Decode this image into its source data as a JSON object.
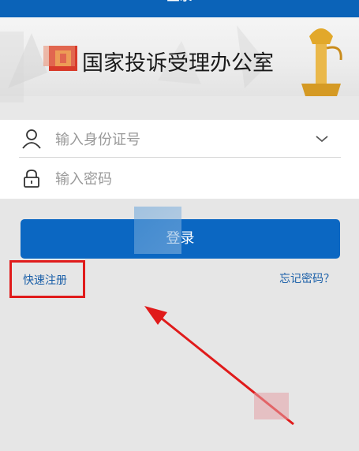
{
  "header": {
    "title": "登录"
  },
  "banner": {
    "org_name": "国家投诉受理办公室"
  },
  "form": {
    "id_placeholder": "输入身份证号",
    "password_placeholder": "输入密码"
  },
  "actions": {
    "login_label": "登录",
    "register_label": "快速注册",
    "forgot_label": "忘记密码？"
  },
  "colors": {
    "primary": "#0b67c2",
    "link": "#1a5fa8",
    "highlight": "#e01b1b"
  }
}
